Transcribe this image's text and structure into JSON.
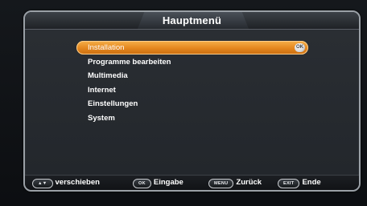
{
  "window": {
    "title": "Hauptmenü"
  },
  "menu": {
    "items": [
      {
        "label": "Installation",
        "selected": true
      },
      {
        "label": "Programme bearbeiten",
        "selected": false
      },
      {
        "label": "Multimedia",
        "selected": false
      },
      {
        "label": "Internet",
        "selected": false
      },
      {
        "label": "Einstellungen",
        "selected": false
      },
      {
        "label": "System",
        "selected": false
      }
    ],
    "selected_badge": "OK"
  },
  "hints": [
    {
      "key": "▲▼",
      "label": "verschieben"
    },
    {
      "key": "OK",
      "label": "Eingabe"
    },
    {
      "key": "MENU",
      "label": "Zurück"
    },
    {
      "key": "EXIT",
      "label": "Ende"
    }
  ],
  "colors": {
    "selection": "#e3861e",
    "background": "#22262b",
    "text": "#ffffff"
  }
}
